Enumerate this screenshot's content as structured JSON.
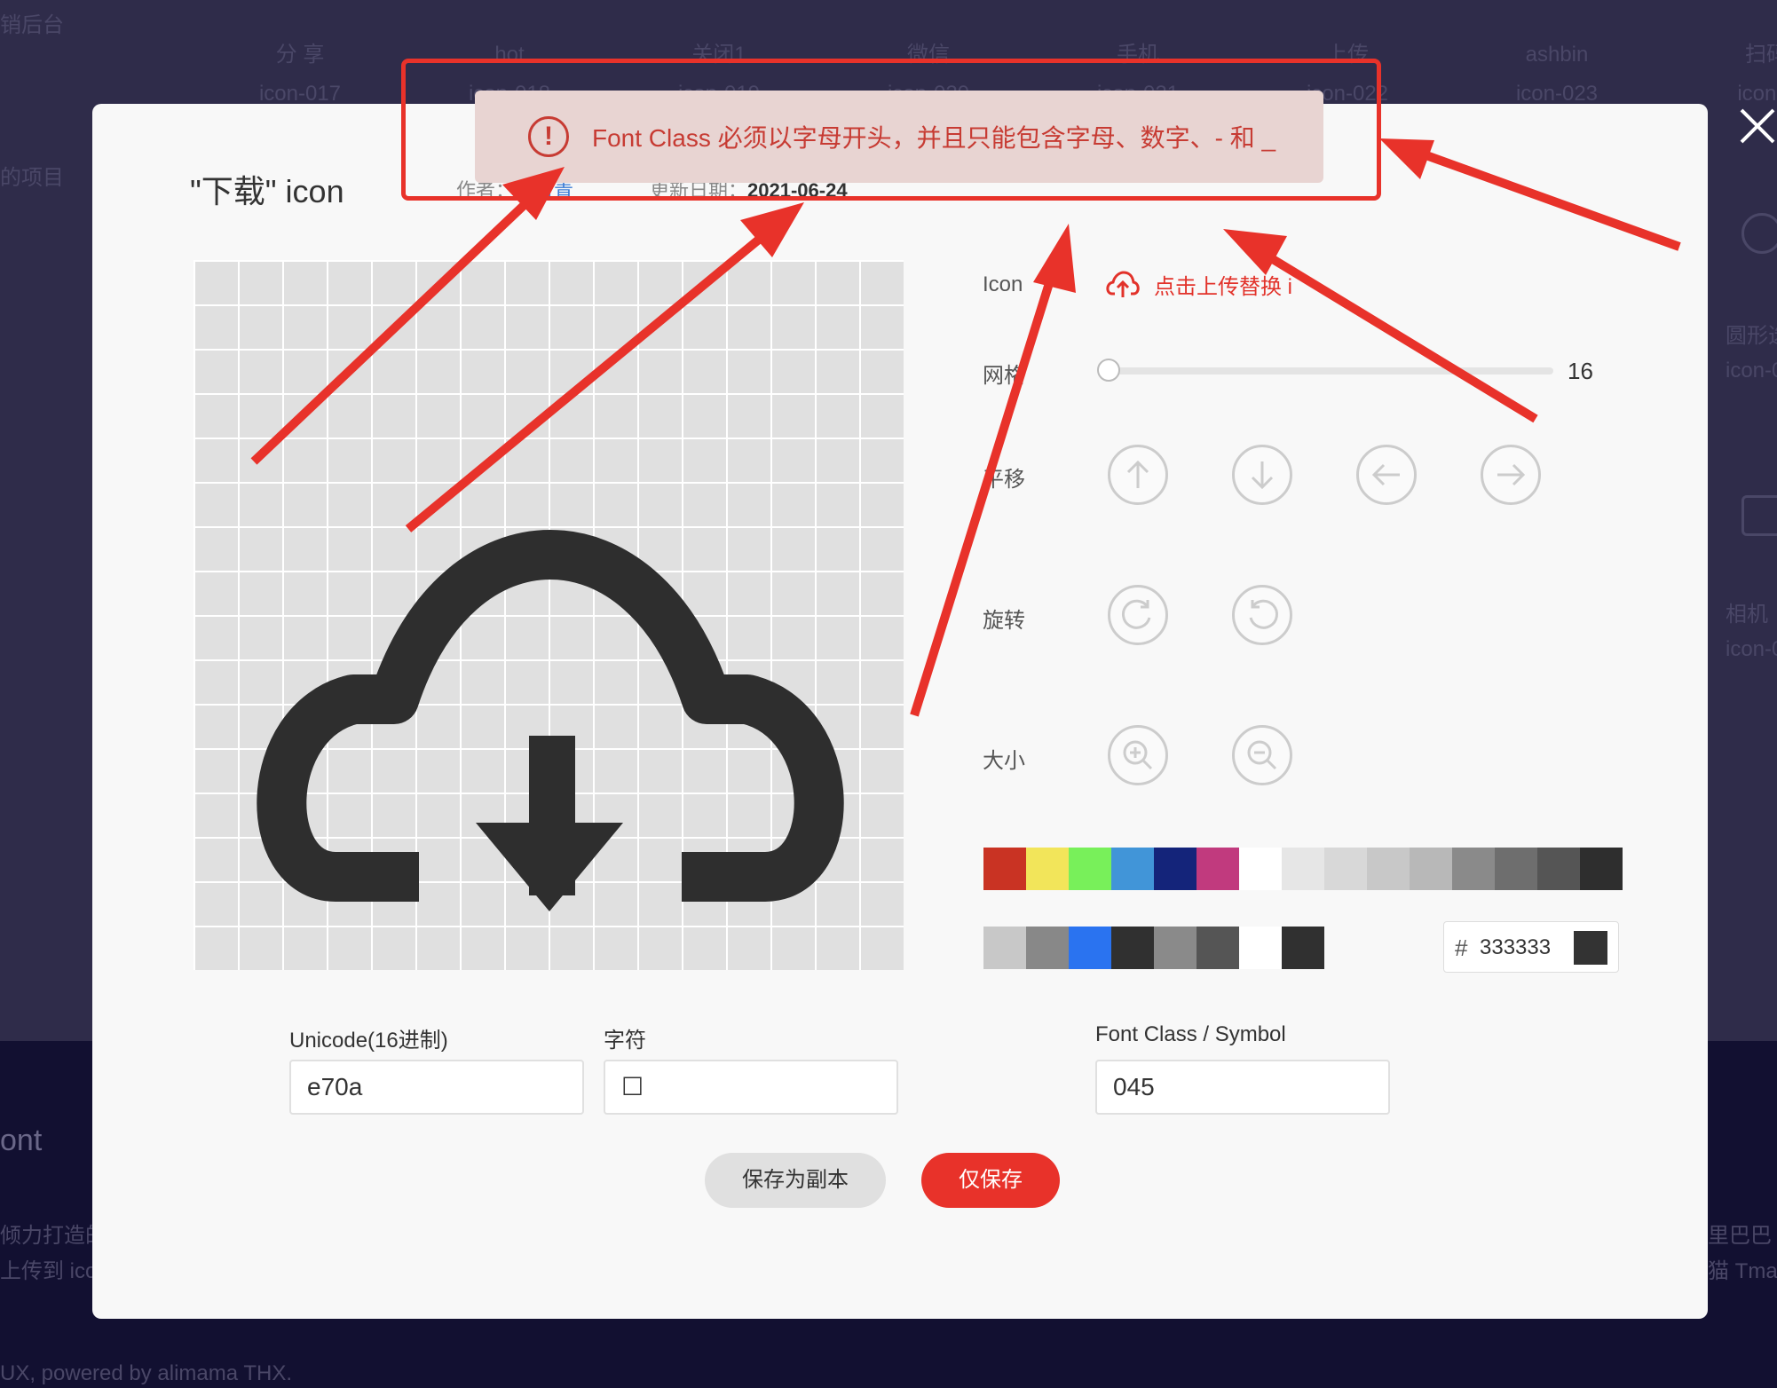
{
  "background": {
    "top_left_text": "销后台",
    "side_text": "的项目",
    "icon_items": [
      {
        "name": "分 享",
        "code": "icon-017"
      },
      {
        "name": "hot",
        "code": "icon-018"
      },
      {
        "name": "关闭1",
        "code": "icon-019"
      },
      {
        "name": "微信",
        "code": "icon-020"
      },
      {
        "name": "手机",
        "code": "icon-021"
      },
      {
        "name": "上传",
        "code": "icon-022"
      },
      {
        "name": "ashbin",
        "code": "icon-023"
      },
      {
        "name": "扫码",
        "code": "icon-0"
      }
    ],
    "right_items": [
      {
        "name": "圆形选",
        "code": "icon-0"
      },
      {
        "name": "相机",
        "code": "icon-0"
      }
    ],
    "footer_brand": "ont",
    "footer_line1": "倾力打造的",
    "footer_line2": "上传到 icon",
    "footer_right1": "里巴巴",
    "footer_right2": "猫 Tmall",
    "footer_powered": "UX, powered by alimama THX."
  },
  "modal": {
    "title": "\"下载\" icon",
    "author_label": "作者：",
    "author_name": "蓝月青",
    "updated_label": "更新日期：",
    "updated_value": "2021-06-24",
    "icon_label": "Icon",
    "upload_text": "点击上传替换 i",
    "grid_label": "网格",
    "grid_value": "16",
    "move_label": "平移",
    "rotate_label": "旋转",
    "size_label": "大小",
    "palette_row1": [
      "#c93323",
      "#f2e55a",
      "#78f05a",
      "#4195d8",
      "#14247a",
      "#c13a7e",
      "#ffffff",
      "#e6e6e6",
      "#d8d8d8",
      "#c8c8c8",
      "#b8b8b8",
      "#8a8a8a",
      "#6e6e6e",
      "#555555",
      "#2e2e2e"
    ],
    "palette_row2": [
      "#c8c8c8",
      "#888888",
      "#2a73f0",
      "#303030",
      "#8a8a8a",
      "#555555",
      "#ffffff",
      "#303030"
    ],
    "hex_value": "333333",
    "hex_color": "#333333",
    "unicode_label": "Unicode(16进制)",
    "unicode_value": "e70a",
    "char_label": "字符",
    "char_value": "☐",
    "fontclass_label": "Font Class / Symbol",
    "fontclass_value": "045",
    "save_copy_label": "保存为副本",
    "save_label": "仅保存"
  },
  "toast": {
    "message": "Font Class 必须以字母开头，并且只能包含字母、数字、- 和 _",
    "icon": "!"
  },
  "colors": {
    "accent": "#e8322a",
    "toast_bg": "#e8d4d2",
    "toast_text": "#c73b33",
    "icon_fill": "#2e2e2e"
  }
}
